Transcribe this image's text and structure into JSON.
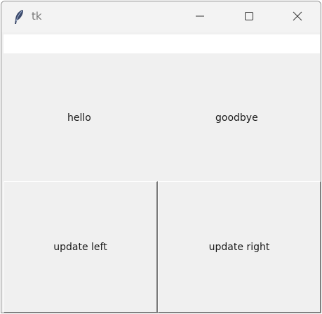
{
  "window": {
    "title": "tk",
    "controls": {
      "minimize": "minimize-icon",
      "maximize": "maximize-icon",
      "close": "close-icon"
    }
  },
  "entry": {
    "value": ""
  },
  "labels": {
    "left": "hello",
    "right": "goodbye"
  },
  "buttons": {
    "update_left": "update left",
    "update_right": "update right"
  }
}
